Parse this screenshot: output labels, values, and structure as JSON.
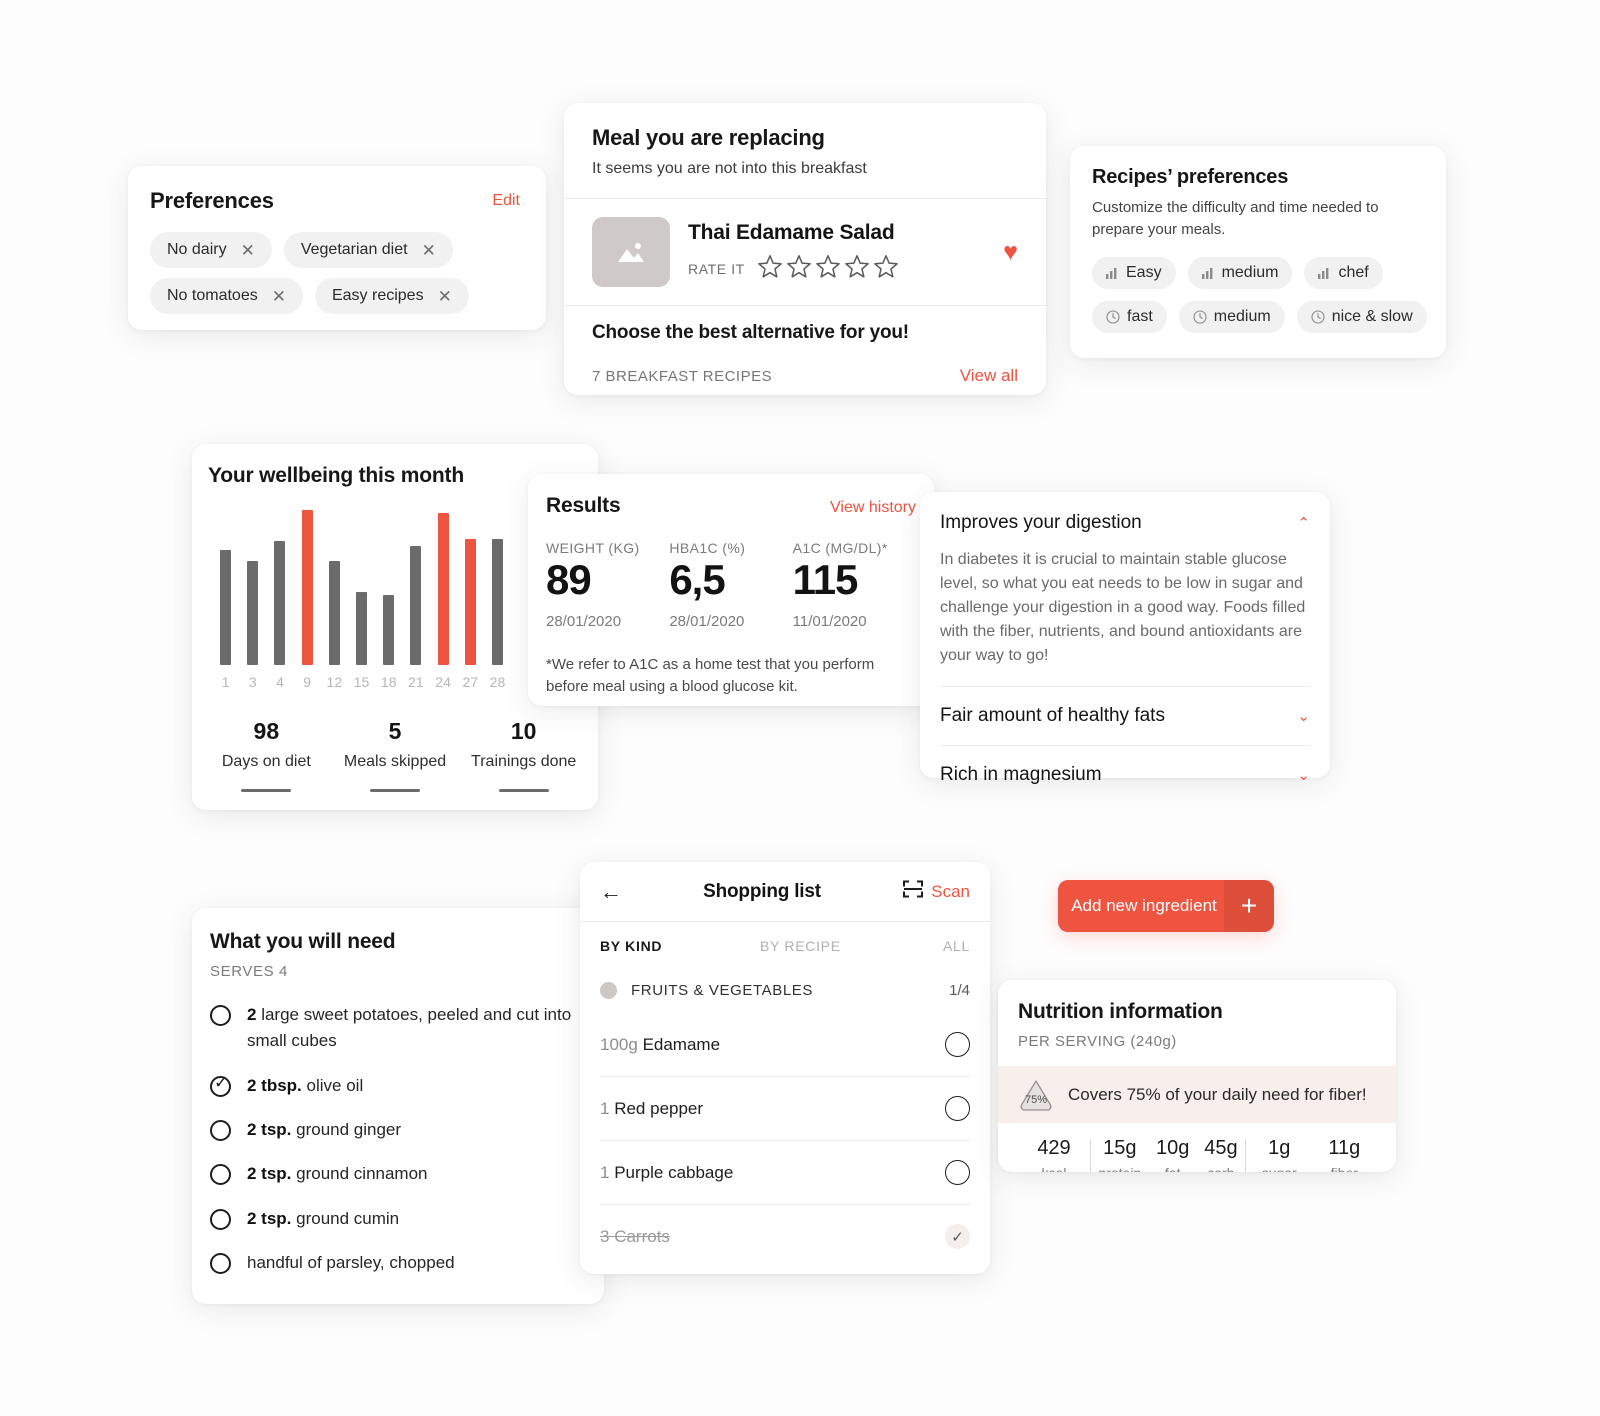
{
  "preferences": {
    "title": "Preferences",
    "edit_label": "Edit",
    "chips": [
      {
        "label": "No dairy",
        "remove": "✕"
      },
      {
        "label": "Vegetarian diet",
        "remove": "✕"
      },
      {
        "label": "No tomatoes",
        "remove": "✕"
      },
      {
        "label": "Easy recipes",
        "remove": "✕"
      }
    ]
  },
  "meal": {
    "title": "Meal you are replacing",
    "subtitle": "It seems you are not into this breakfast",
    "recipe_name": "Thai Edamame Salad",
    "rate_label": "RATE IT",
    "stars_total": 5,
    "stars_filled": 0,
    "favorite_icon": "♥",
    "thumb_icon": "image-placeholder",
    "choose_heading": "Choose the best alternative for you!",
    "count_label": "7 BREAKFAST RECIPES",
    "view_all_label": "View all"
  },
  "recipes_prefs": {
    "title": "Recipes’ preferences",
    "subtitle": "Customize the difficulty and time needed to prepare your meals.",
    "difficulty": [
      {
        "label": "Easy",
        "icon": "bars-icon"
      },
      {
        "label": "medium",
        "icon": "bars-icon"
      },
      {
        "label": "chef",
        "icon": "bars-icon"
      }
    ],
    "time": [
      {
        "label": "fast",
        "icon": "clock-icon"
      },
      {
        "label": "medium",
        "icon": "clock-icon"
      },
      {
        "label": "nice & slow",
        "icon": "clock-icon"
      }
    ]
  },
  "wellbeing": {
    "title": "Your wellbeing this month",
    "stats": [
      {
        "value": "98",
        "label": "Days on diet"
      },
      {
        "value": "5",
        "label": "Meals skipped"
      },
      {
        "value": "10",
        "label": "Trainings done"
      }
    ]
  },
  "chart_data": {
    "type": "bar",
    "title": "Your wellbeing this month",
    "xlabel": "",
    "ylabel": "",
    "categories": [
      "1",
      "3",
      "4",
      "9",
      "12",
      "15",
      "18",
      "21",
      "24",
      "27",
      "28"
    ],
    "values": [
      74,
      67,
      80,
      100,
      67,
      47,
      45,
      77,
      98,
      81,
      81
    ],
    "highlight_indices": [
      3,
      8,
      9
    ],
    "colors": {
      "default": "#6b6b6b",
      "highlight": "#ee5440"
    },
    "grid": false,
    "legend": false,
    "ylim": [
      0,
      100
    ]
  },
  "results": {
    "title": "Results",
    "history_label": "View history",
    "metrics": [
      {
        "key": "WEIGHT (KG)",
        "value": "89",
        "date": "28/01/2020"
      },
      {
        "key": "HBA1C (%)",
        "value": "6,5",
        "date": "28/01/2020"
      },
      {
        "key": "A1C (MG/DL)*",
        "value": "115",
        "date": "11/01/2020"
      }
    ],
    "note": "*We refer to A1C as a home test that you perform before meal using a blood glucose kit."
  },
  "benefits": {
    "items": [
      {
        "title": "Improves your digestion",
        "expanded": true,
        "chevron": "⌃",
        "body": "In diabetes it is crucial to maintain stable glucose level, so what you eat needs to be low in sugar and challenge your digestion in a good way. Foods filled with the fiber, nutrients, and bound antioxidants are your way to go!"
      },
      {
        "title": "Fair amount of healthy fats",
        "expanded": false,
        "chevron": "⌄",
        "body": ""
      },
      {
        "title": "Rich in magnesium",
        "expanded": false,
        "chevron": "⌄",
        "body": ""
      }
    ]
  },
  "need": {
    "title": "What you will need",
    "serves": "SERVES 4",
    "items": [
      {
        "qty": "2",
        "text": " large sweet potatoes, peeled and cut into small cubes",
        "checked": false
      },
      {
        "qty": "2 tbsp.",
        "text": " olive oil",
        "checked": true
      },
      {
        "qty": "2 tsp.",
        "text": " ground ginger",
        "checked": false
      },
      {
        "qty": "2 tsp.",
        "text": " ground cinnamon",
        "checked": false
      },
      {
        "qty": "2 tsp.",
        "text": " ground cumin",
        "checked": false
      },
      {
        "qty": "",
        "text": "handful of parsley, chopped",
        "checked": false
      }
    ]
  },
  "shopping": {
    "back_icon": "←",
    "title": "Shopping list",
    "scan_label": "Scan",
    "scan_icon": "scan-frame-icon",
    "tabs": [
      {
        "label": "BY KIND",
        "active": true
      },
      {
        "label": "BY RECIPE",
        "active": false
      },
      {
        "label": "ALL",
        "active": false
      }
    ],
    "group": {
      "name": "FRUITS & VEGETABLES",
      "count": "1/4"
    },
    "items": [
      {
        "qty": "100g",
        "name": "Edamame",
        "checked": false
      },
      {
        "qty": "1",
        "name": "Red pepper",
        "checked": false
      },
      {
        "qty": "1",
        "name": "Purple cabbage",
        "checked": false
      },
      {
        "qty": "3",
        "name": "Carrots",
        "checked": true
      }
    ]
  },
  "add_ingredient": {
    "label": "Add new ingredient",
    "icon": "plus-icon"
  },
  "nutrition": {
    "title": "Nutrition information",
    "subtitle": "PER SERVING (240g)",
    "badge_value": "75%",
    "banner_message": "Covers 75% of your daily need for fiber!",
    "calories": {
      "value": "429",
      "unit": "kcal"
    },
    "macros": [
      {
        "value": "15g",
        "unit": "protein"
      },
      {
        "value": "10g",
        "unit": "fat"
      },
      {
        "value": "45g",
        "unit": "carb"
      }
    ],
    "sugars": [
      {
        "value": "1g",
        "unit": "sugar"
      },
      {
        "value": "11g",
        "unit": "fiber"
      }
    ]
  },
  "theme": {
    "accent": "#ee5440",
    "bar_default": "#6b6b6b",
    "chip_bg": "#f1f1f2"
  }
}
